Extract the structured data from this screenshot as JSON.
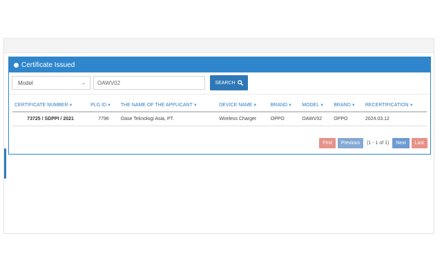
{
  "panel": {
    "title": "Certificate Issued"
  },
  "search": {
    "field_select": "Model",
    "query": "OAWV02",
    "button_label": "SEARCH"
  },
  "table": {
    "columns": [
      "CERTIFICATE NUMBER",
      "PLG ID",
      "THE NAME OF THE APPLICANT",
      "DEVICE NAME",
      "BRAND",
      "MODEL",
      "BRAND",
      "RECERTIFICATION"
    ],
    "rows": [
      [
        "73725 / SDPPI / 2021",
        "7796",
        "Oase Teknologi Asia, PT.",
        "Wireless Charger",
        "OPPO",
        "OAWV02",
        "OPPO",
        "2024.03.12"
      ]
    ]
  },
  "pager": {
    "first": "First",
    "previous": "Previous",
    "info": "(1 - 1 of 1)",
    "next": "Next",
    "last": "Last"
  },
  "colors": {
    "header_blue": "#2f86cc",
    "button_blue": "#2f78b7",
    "pager_red": "#e7928a"
  },
  "icons": [
    "search-icon",
    "sort-arrow-icon",
    "chevron-down-icon"
  ]
}
